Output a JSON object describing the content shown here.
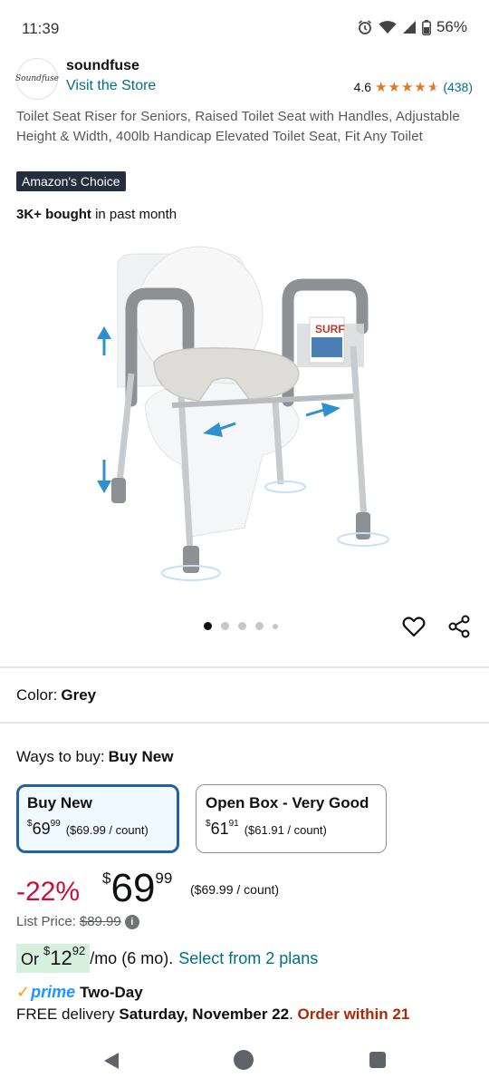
{
  "status_bar": {
    "time": "11:39",
    "battery": "56%"
  },
  "store": {
    "logo_text": "Soundfuse",
    "brand": "soundfuse",
    "visit_link": "Visit the Store",
    "rating": "4.6",
    "review_count": "(438)"
  },
  "product": {
    "title": "Toilet Seat Riser for Seniors, Raised Toilet Seat with Handles, Adjustable Height & Width, 400lb Handicap Elevated Toilet Seat, Fit Any Toilet",
    "badge": "Amazon's Choice",
    "bought_bold": "3K+ bought",
    "bought_rest": " in past month",
    "image_label": "SURF",
    "carousel_count": 5,
    "carousel_active": 0
  },
  "color": {
    "label": "Color:",
    "value": "Grey"
  },
  "ways_to_buy": {
    "label": "Ways to buy:",
    "value": "Buy New",
    "options": [
      {
        "title": "Buy New",
        "currency": "$",
        "whole": "69",
        "fraction": "99",
        "per": "($69.99 / count)",
        "selected": true
      },
      {
        "title": "Open Box - Very Good",
        "currency": "$",
        "whole": "61",
        "fraction": "91",
        "per": "($61.91 / count)",
        "selected": false
      }
    ]
  },
  "price": {
    "discount": "-22%",
    "currency": "$",
    "whole": "69",
    "fraction": "99",
    "per_count": "($69.99 / count)",
    "list_label": "List Price:",
    "list_value": "$89.99",
    "info_glyph": "i"
  },
  "installment": {
    "prefix": "Or ",
    "currency": "$",
    "whole": "12",
    "fraction": "92",
    "term": "/mo (6 mo).",
    "plans_link": "Select from 2 plans"
  },
  "delivery": {
    "prime_check": "✓",
    "prime_word": "prime",
    "two_day": "Two-Day",
    "free": "FREE delivery ",
    "date": "Saturday, November 22",
    "sep": ". ",
    "order_within": "Order within 21"
  },
  "colors": {
    "link": "#007185",
    "deal_red": "#cc0c39",
    "selected_border": "#2162a1",
    "star": "#de7921",
    "prime_blue": "#1a98ff"
  }
}
